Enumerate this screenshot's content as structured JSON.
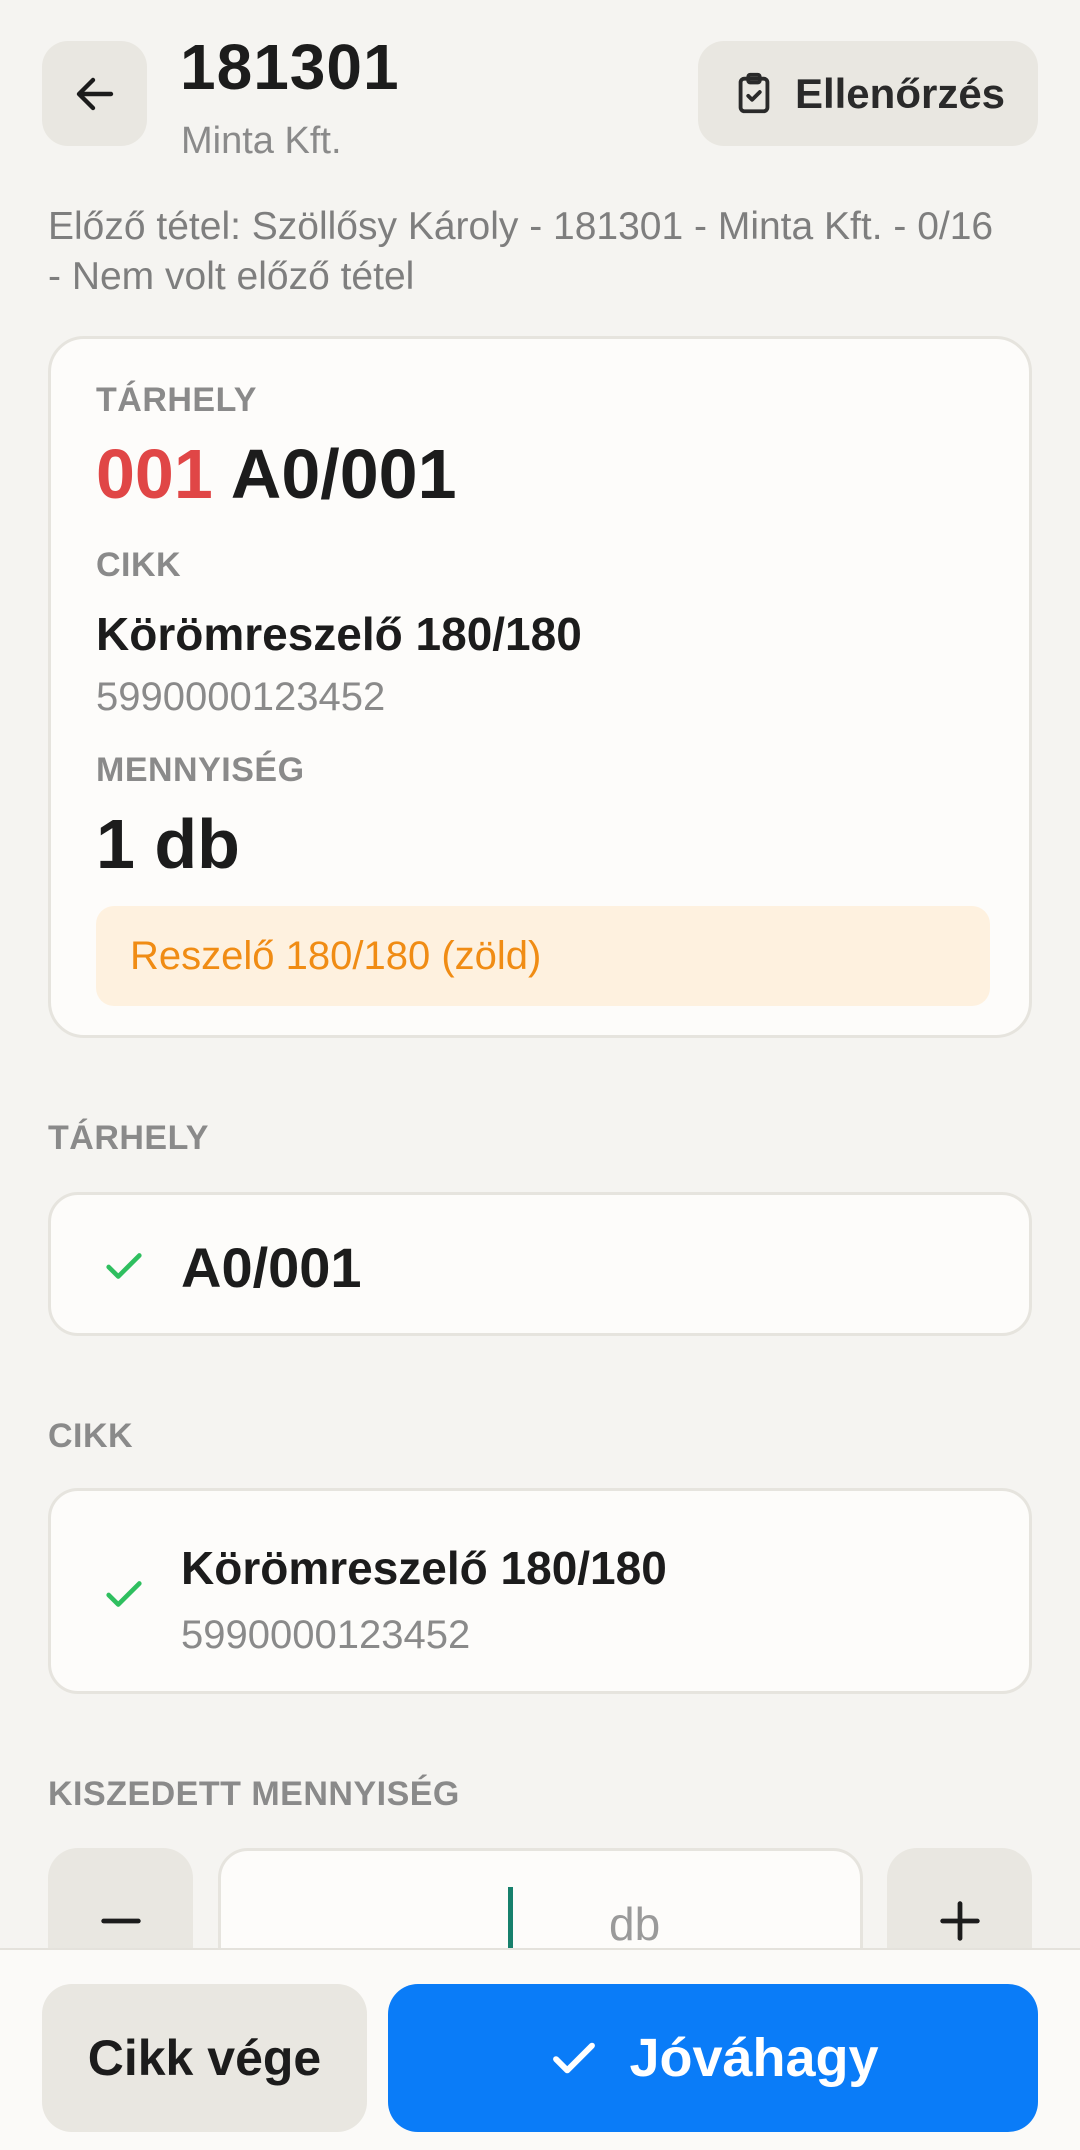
{
  "header": {
    "title": "181301",
    "subtitle": "Minta Kft.",
    "check_label": "Ellenőrzés"
  },
  "prev_item": "Előző tétel: Szöllősy Károly - 181301 - Minta Kft. - 0/16 - Nem volt előző tétel",
  "card": {
    "location_label": "TÁRHELY",
    "location_code": "001",
    "location_value": "A0/001",
    "item_label": "CIKK",
    "item_name": "Körömreszelő 180/180",
    "item_barcode": "5990000123452",
    "qty_label": "MENNYISÉG",
    "qty_value": "1 db",
    "note": "Reszelő 180/180 (zöld)"
  },
  "location_section": {
    "label": "TÁRHELY",
    "value": "A0/001"
  },
  "item_section": {
    "label": "CIKK",
    "name": "Körömreszelő 180/180",
    "barcode": "5990000123452"
  },
  "picked_section": {
    "label": "KISZEDETT MENNYISÉG",
    "unit": "db",
    "value": ""
  },
  "footer": {
    "end_label": "Cikk vége",
    "approve_label": "Jóváhagy"
  },
  "colors": {
    "accent_blue": "#0a7cf8",
    "location_code_red": "#e04646",
    "success_green": "#2fbf5f",
    "note_orange": "#f08c14",
    "note_bg": "#fef1df"
  }
}
